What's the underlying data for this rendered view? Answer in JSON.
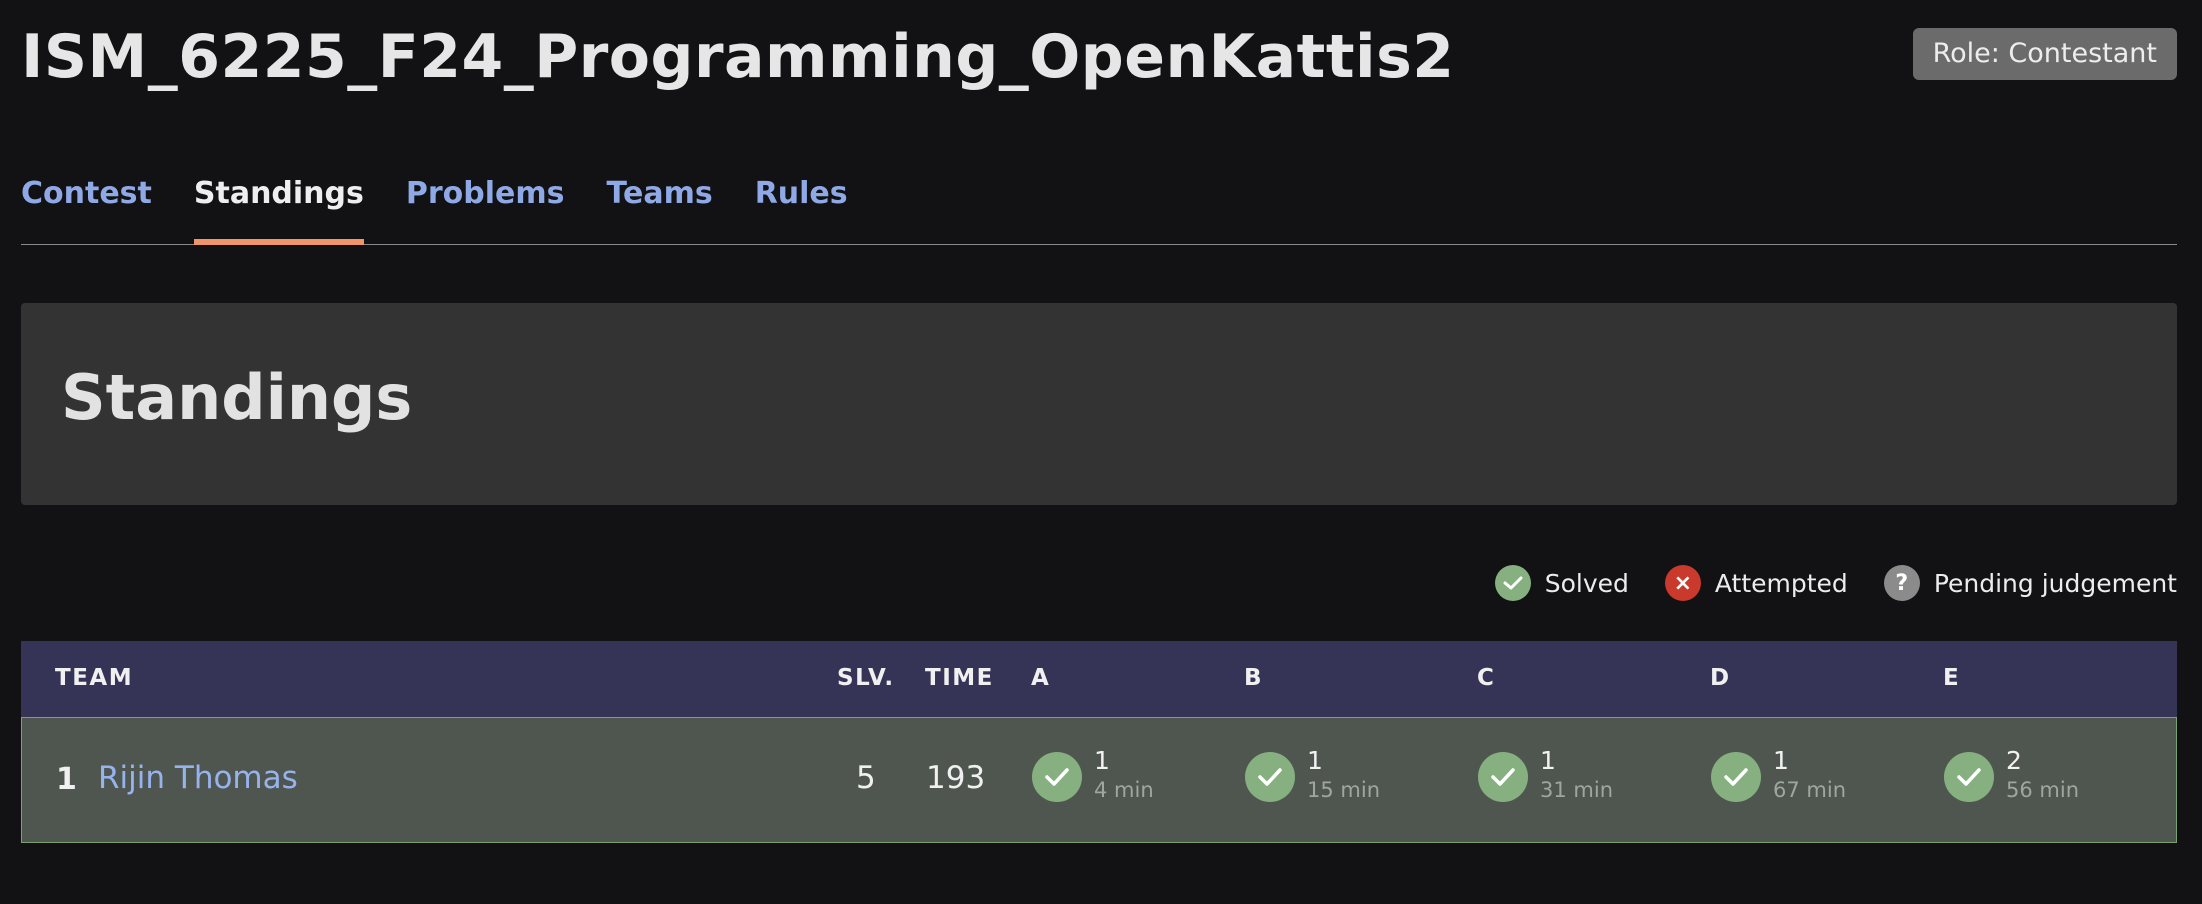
{
  "contest": {
    "title": "ISM_6225_F24_Programming_OpenKattis2",
    "role_badge": "Role: Contestant"
  },
  "tabs": [
    {
      "label": "Contest",
      "active": false
    },
    {
      "label": "Standings",
      "active": true
    },
    {
      "label": "Problems",
      "active": false
    },
    {
      "label": "Teams",
      "active": false
    },
    {
      "label": "Rules",
      "active": false
    }
  ],
  "page_heading": "Standings",
  "legend": {
    "solved": "Solved",
    "attempted": "Attempted",
    "pending": "Pending judgement",
    "pending_glyph": "?",
    "attempted_glyph": "×"
  },
  "table": {
    "headers": {
      "team": "TEAM",
      "solved": "SLV.",
      "time": "TIME",
      "problems": [
        "A",
        "B",
        "C",
        "D",
        "E"
      ]
    },
    "rows": [
      {
        "rank": "1",
        "team": "Rijin Thomas",
        "solved": "5",
        "time": "193",
        "problems": [
          {
            "tries": "1",
            "time": "4 min",
            "status": "solved"
          },
          {
            "tries": "1",
            "time": "15 min",
            "status": "solved"
          },
          {
            "tries": "1",
            "time": "31 min",
            "status": "solved"
          },
          {
            "tries": "1",
            "time": "67 min",
            "status": "solved"
          },
          {
            "tries": "2",
            "time": "56 min",
            "status": "solved"
          }
        ]
      }
    ]
  },
  "colors": {
    "solved": "#86b07f",
    "attempted": "#c93a2c",
    "pending": "#8b8b8b",
    "header_bg": "#353456",
    "row_bg": "#4f5650",
    "active_tab_underline": "#f0946a",
    "link": "#8fa8e6"
  }
}
